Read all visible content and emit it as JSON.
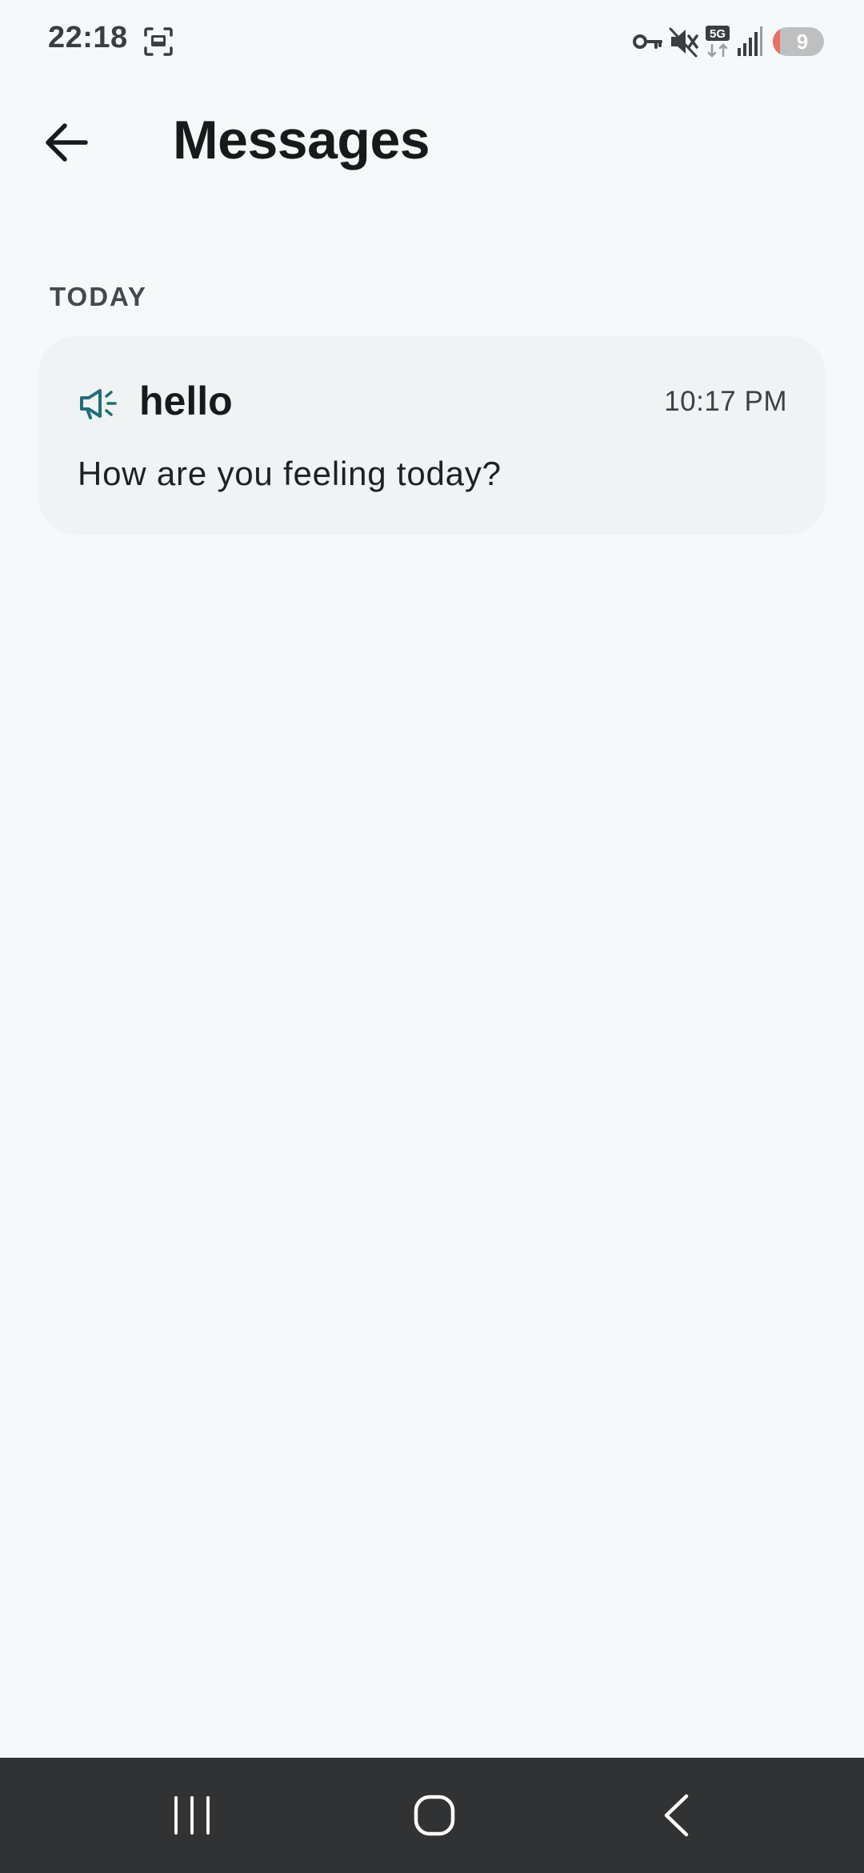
{
  "status_bar": {
    "time": "22:18",
    "battery_level": "9",
    "battery_fraction": 0.09,
    "network_label": "5G",
    "icons": [
      "screenshot-icon",
      "vpn-key-icon",
      "mute-icon",
      "5g-data-icon",
      "signal-icon",
      "battery-icon"
    ]
  },
  "header": {
    "title": "Messages",
    "back_icon": "arrow-left-icon"
  },
  "sections": [
    {
      "label": "TODAY",
      "messages": [
        {
          "icon": "megaphone-icon",
          "title": "hello",
          "time": "10:17 PM",
          "body": "How are you feeling today?"
        }
      ]
    }
  ],
  "nav_bar": {
    "buttons": [
      "recents-icon",
      "home-icon",
      "back-icon"
    ]
  },
  "colors": {
    "background": "#f5f9f9",
    "card_background": "#eff3f3",
    "accent": "#1f6f78",
    "nav_background": "#313233",
    "battery_low": "#e97060"
  }
}
